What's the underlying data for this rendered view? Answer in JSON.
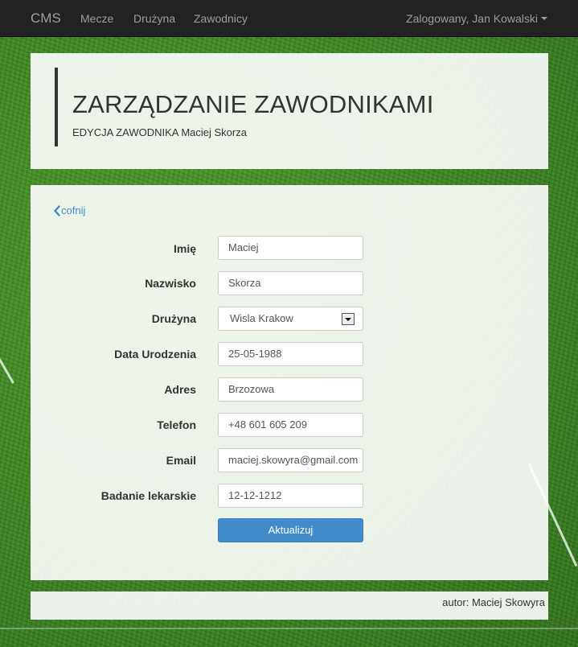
{
  "navbar": {
    "brand": "CMS",
    "links": [
      "Mecze",
      "Drużyna",
      "Zawodnicy"
    ],
    "user": "Zalogowany, Jan Kowalski"
  },
  "header": {
    "title": "ZARZĄDZANIE ZAWODNIKAMI",
    "subtitle": "EDYCJA ZAWODNIKA Maciej Skorza"
  },
  "form": {
    "back_label": "cofnij",
    "fields": [
      {
        "label": "Imię",
        "value": "Maciej"
      },
      {
        "label": "Nazwisko",
        "value": "Skorza"
      },
      {
        "label": "Drużyna",
        "value": "Wisla Krakow"
      },
      {
        "label": "Data Urodzenia",
        "value": "25-05-1988"
      },
      {
        "label": "Adres",
        "value": "Brzozowa"
      },
      {
        "label": "Telefon",
        "value": "+48 601 605 209"
      },
      {
        "label": "Email",
        "value": "maciej.skowyra@gmail.com"
      },
      {
        "label": "Badanie lekarskie",
        "value": "12-12-1212"
      }
    ],
    "submit_label": "Aktualizuj"
  },
  "footer": {
    "text": "autor: Maciej Skowyra"
  },
  "colors": {
    "navbar": "#222222",
    "primary": "#428bca",
    "grass": "#3d8a22"
  }
}
